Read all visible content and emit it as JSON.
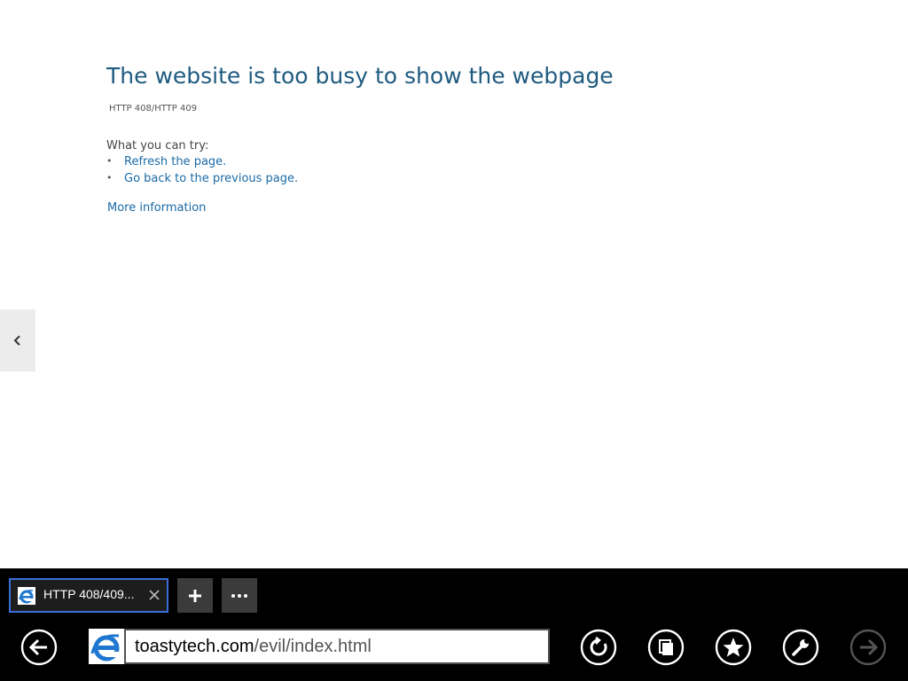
{
  "error_page": {
    "title": "The website is too busy to show the webpage",
    "code": "HTTP 408/HTTP 409",
    "try_label": "What you can try:",
    "suggestions": [
      {
        "bullet": "•",
        "label": "Refresh the page."
      },
      {
        "bullet": "•",
        "label": "Go back to the previous page."
      }
    ],
    "more_info": "More information"
  },
  "tab_strip": {
    "active_tab": {
      "title": "HTTP 408/409...",
      "icon": "ie-icon",
      "close_icon": "close-icon"
    },
    "new_tab_icon": "plus-icon",
    "tab_tools_icon": "more-icon"
  },
  "nav_bar": {
    "address": {
      "host": "toastytech.com",
      "path": "/evil/index.html"
    },
    "buttons": [
      "back-icon",
      "refresh-icon",
      "pages-icon",
      "favorites-icon",
      "tools-icon",
      "forward-icon"
    ]
  },
  "colors": {
    "title": "#1f5b80",
    "link": "#1a6aa6",
    "appbar": "#000000",
    "tab_border": "#3a6fd8",
    "disabled": "#555555"
  }
}
